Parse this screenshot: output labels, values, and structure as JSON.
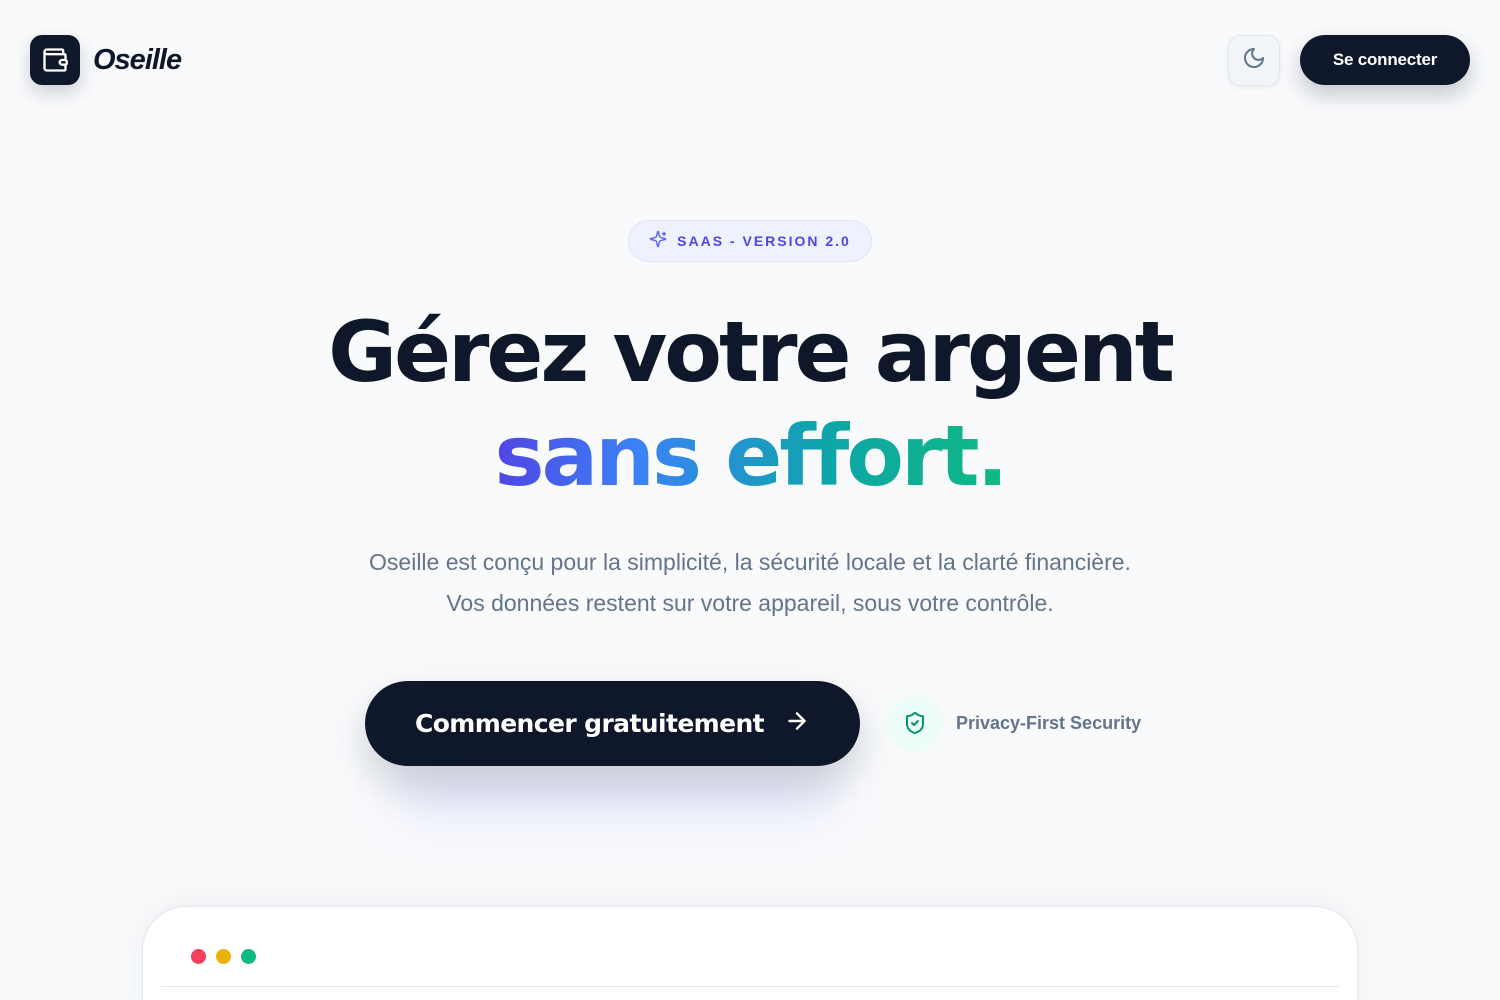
{
  "header": {
    "logo_text": "Oseille",
    "theme_toggle_icon": "moon-icon",
    "login_label": "Se connecter"
  },
  "badge": {
    "icon": "sparkles-icon",
    "text": "SAAS - VERSION 2.0"
  },
  "hero": {
    "headline_line1": "Gérez votre argent",
    "headline_line2": "sans effort.",
    "subtitle_line1": "Oseille est conçu pour la simplicité, la sécurité locale et la clarté financière.",
    "subtitle_line2": "Vos données restent sur votre appareil, sous votre contrôle.",
    "cta_label": "Commencer gratuitement",
    "cta_icon": "arrow-right-icon",
    "trust_icon": "shield-check-icon",
    "trust_label": "Privacy-First Security"
  },
  "preview": {
    "window_dots": [
      "red",
      "yellow",
      "green"
    ]
  },
  "colors": {
    "primary_dark": "#0f172a",
    "accent_indigo": "#4f46e5",
    "accent_teal": "#0ea5a9",
    "accent_green": "#10b981",
    "muted_text": "#64748b",
    "background": "#f8fafc"
  }
}
